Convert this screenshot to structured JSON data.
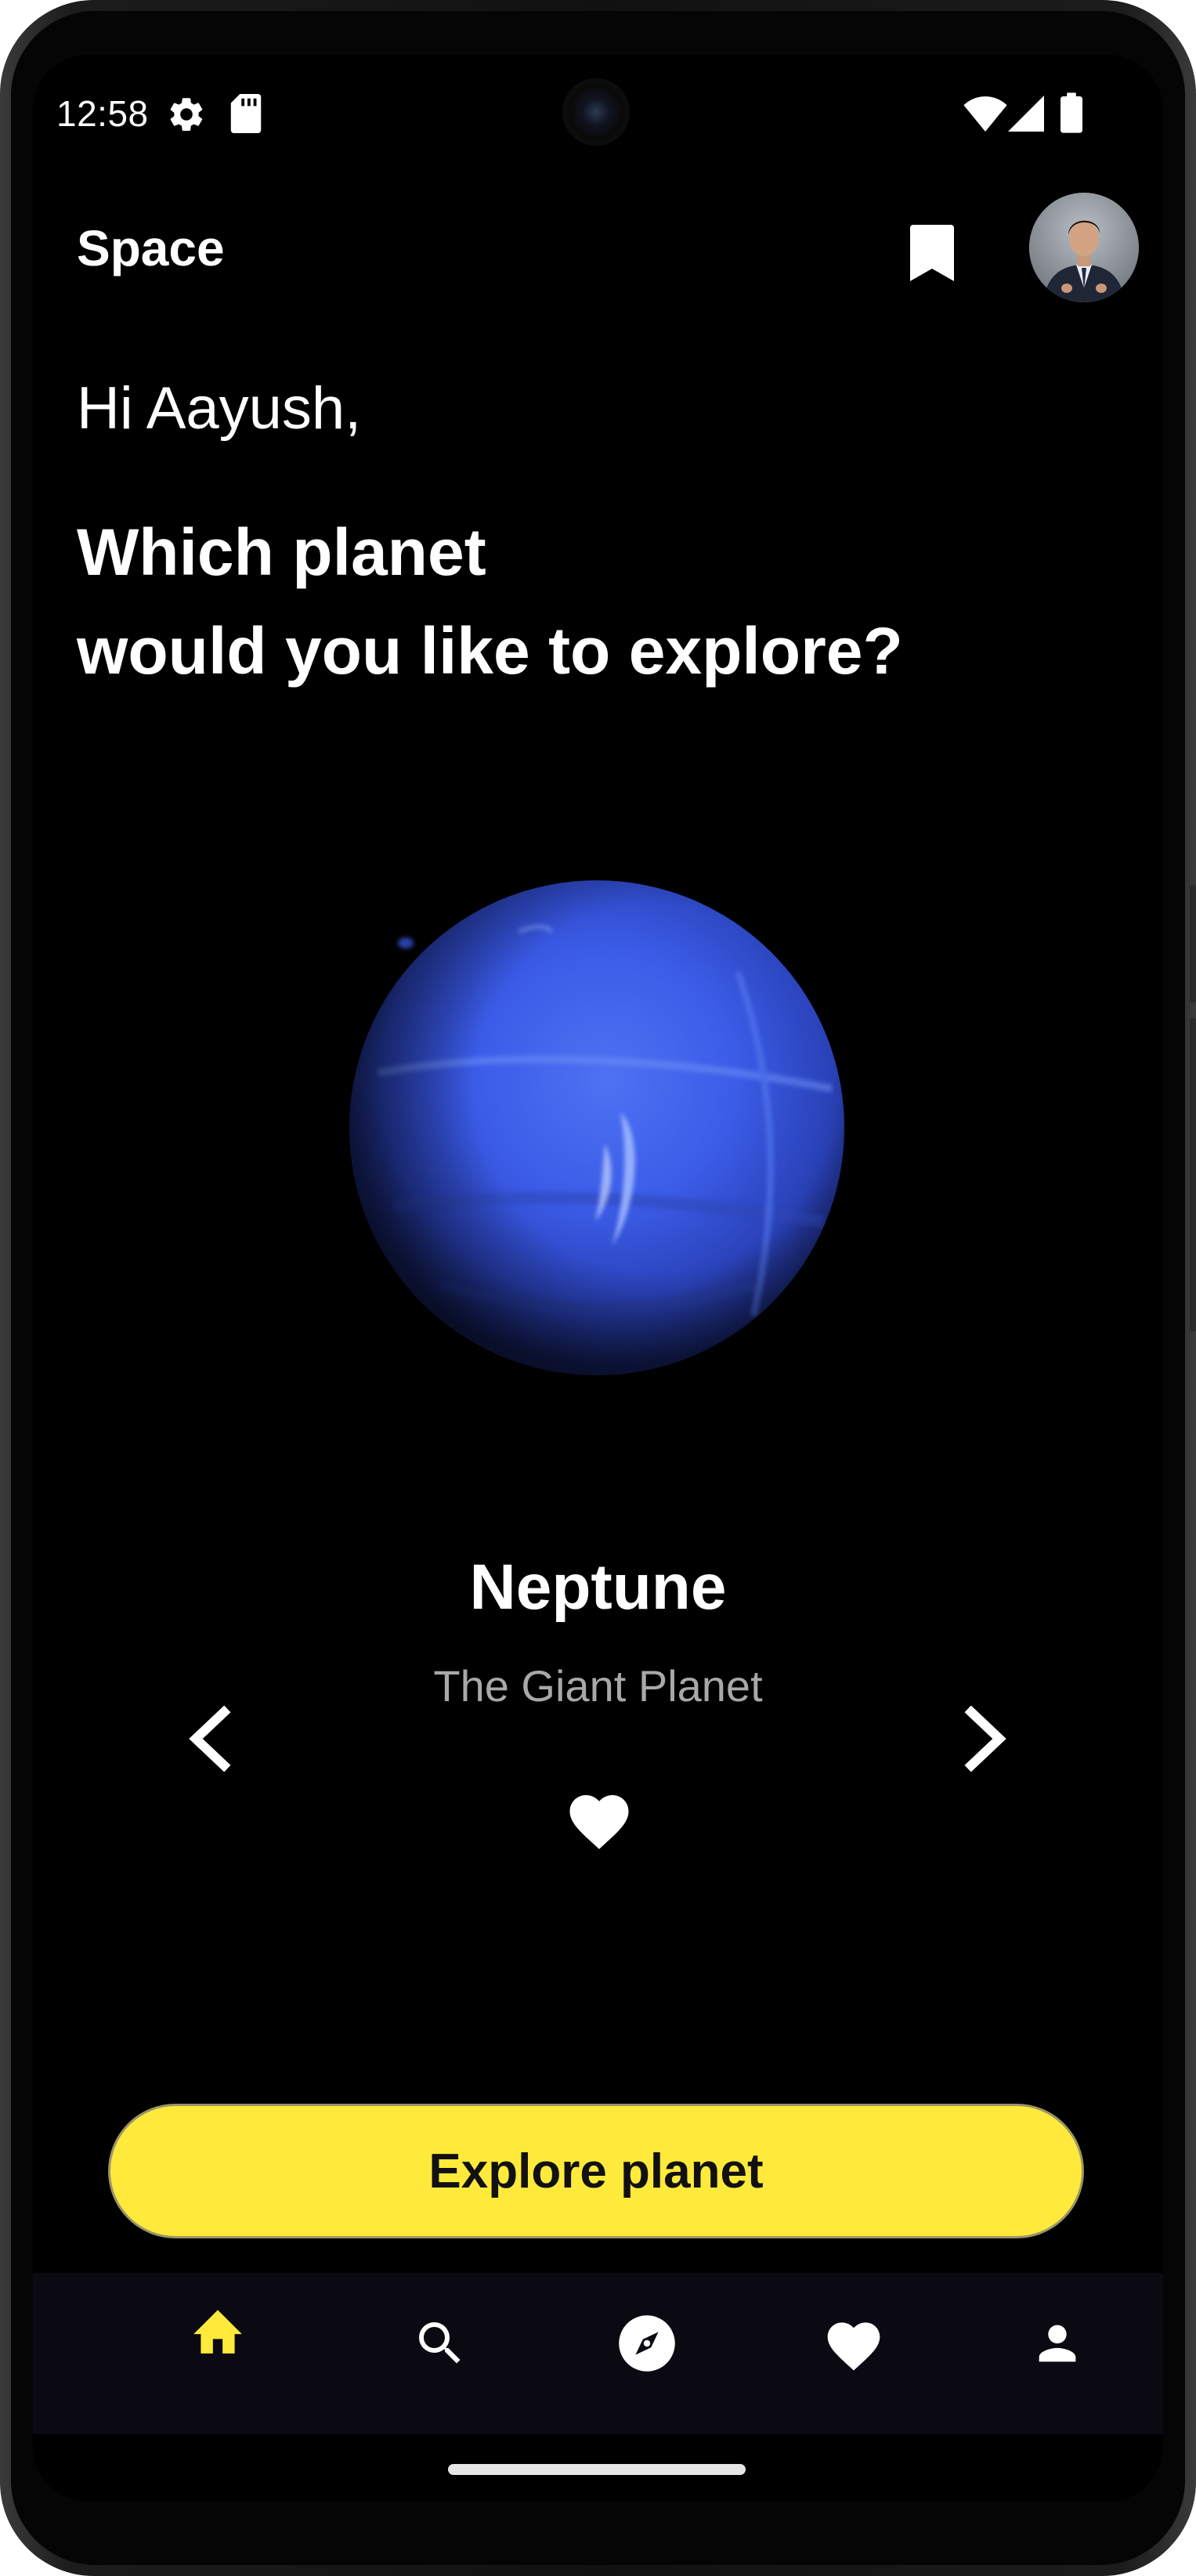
{
  "status_bar": {
    "time": "12:58",
    "icons": [
      "gear-icon",
      "sd-card-icon",
      "wifi-icon",
      "cellular-signal-icon",
      "battery-icon"
    ]
  },
  "app_bar": {
    "title": "Space",
    "bookmark_icon": "bookmark-icon",
    "avatar": "user-avatar"
  },
  "greeting": "Hi Aayush,",
  "headline": {
    "line1": "Which planet",
    "line2": "would you like to explore?"
  },
  "planet": {
    "name": "Neptune",
    "subtitle": "The Giant Planet",
    "image": "neptune-image",
    "favorite_icon": "heart-icon",
    "prev_icon": "chevron-left-icon",
    "next_icon": "chevron-right-icon"
  },
  "explore_button": {
    "label": "Explore planet"
  },
  "bottom_nav": {
    "selected": "home",
    "items": [
      {
        "id": "home",
        "icon": "home-icon"
      },
      {
        "id": "search",
        "icon": "search-icon"
      },
      {
        "id": "explore",
        "icon": "compass-icon"
      },
      {
        "id": "favorites",
        "icon": "heart-icon"
      },
      {
        "id": "profile",
        "icon": "person-icon"
      }
    ]
  },
  "colors": {
    "accent": "#ffea3b",
    "background": "#000000",
    "nav_background": "#0b0a12",
    "planet": "#3f5fe8",
    "text_primary": "#ffffff",
    "text_secondary": "#a8a8a8"
  }
}
